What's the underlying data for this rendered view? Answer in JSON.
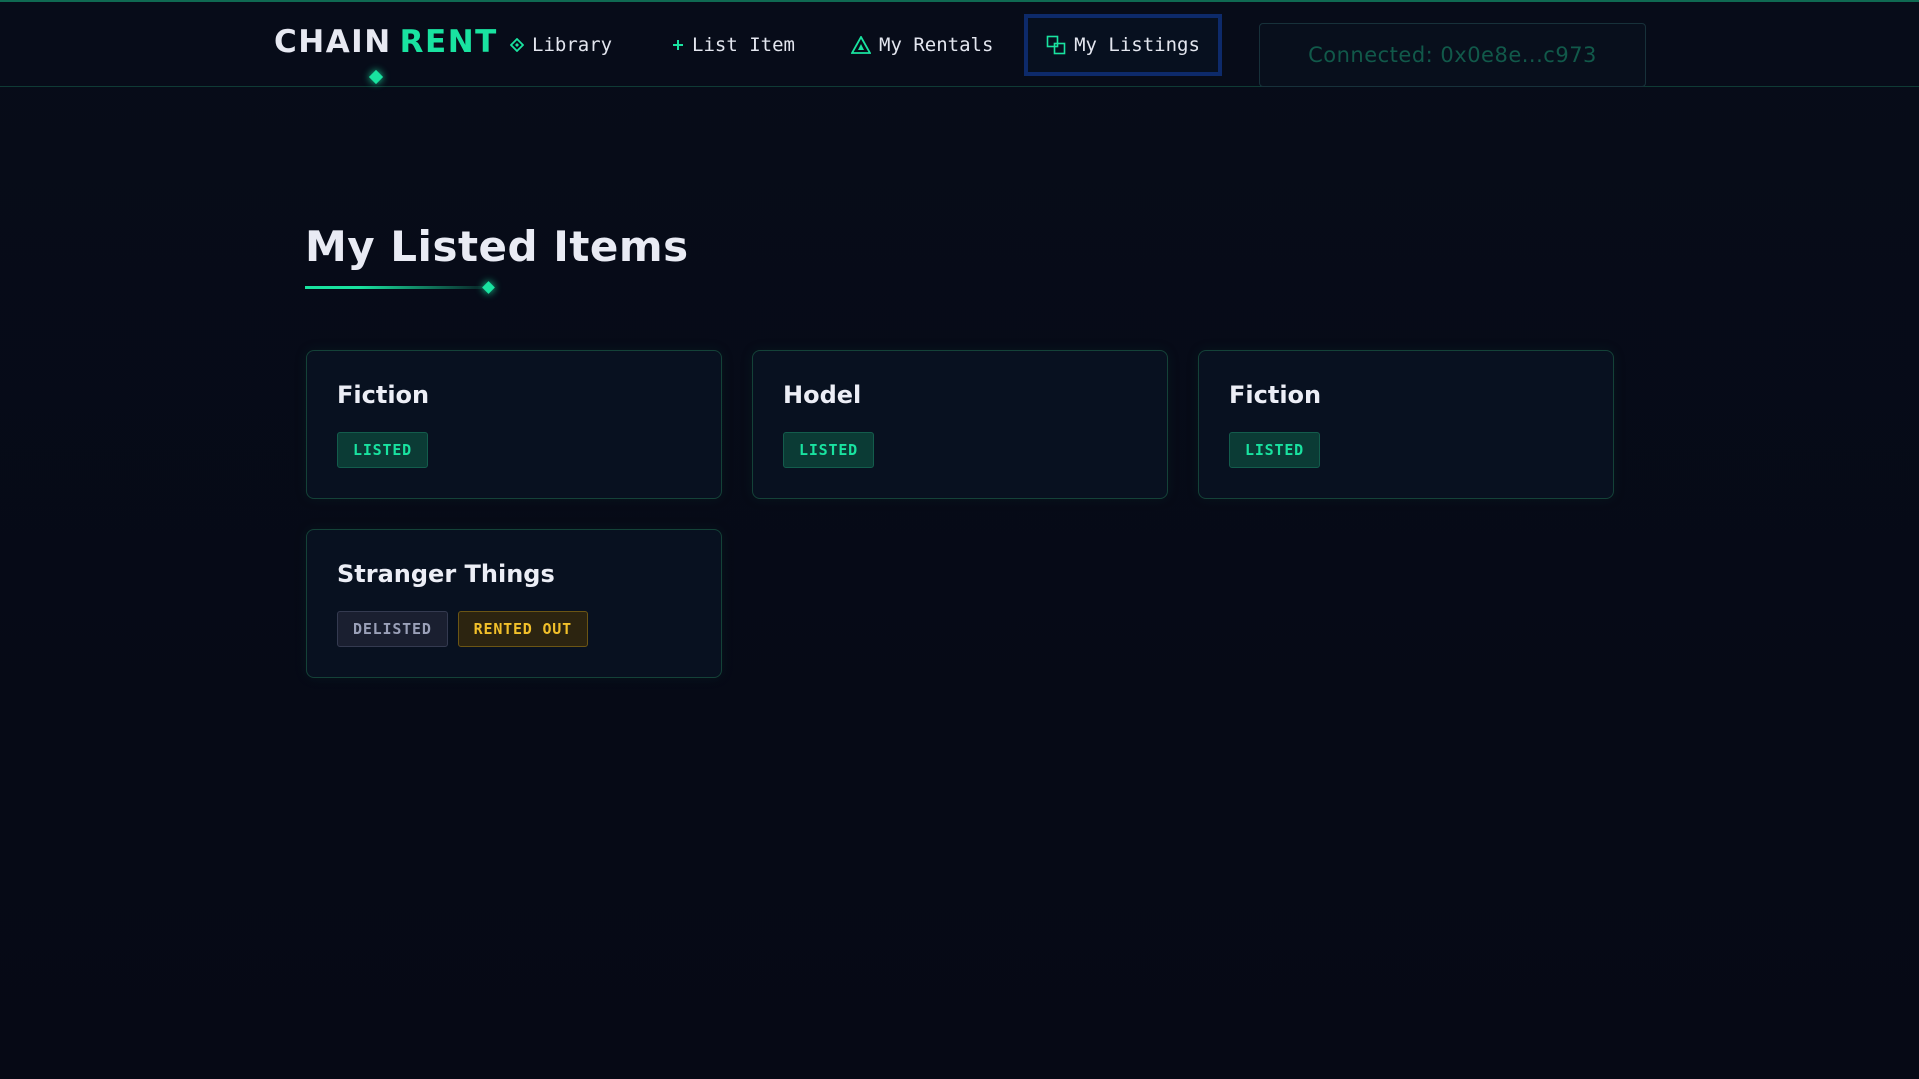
{
  "header": {
    "brand_word1": "CHAIN",
    "brand_word2": "RENT",
    "nav": [
      {
        "label": "Library",
        "icon": "diamond-icon"
      },
      {
        "label": "List Item",
        "icon": "plus-icon"
      },
      {
        "label": "My Rentals",
        "icon": "triangle-icon"
      },
      {
        "label": "My Listings",
        "icon": "squares-icon",
        "active": true
      }
    ],
    "wallet": "Connected: 0x0e8e...c973"
  },
  "main": {
    "title": "My Listed Items",
    "cards": [
      {
        "title": "Fiction",
        "badges": [
          "LISTED"
        ]
      },
      {
        "title": "Hodel",
        "badges": [
          "LISTED"
        ]
      },
      {
        "title": "Fiction",
        "badges": [
          "LISTED"
        ]
      },
      {
        "title": "Stranger Things",
        "badges": [
          "DELISTED",
          "RENTED OUT"
        ]
      }
    ]
  },
  "colors": {
    "accent": "#19e3a0",
    "background": "#060a16",
    "active_nav_border": "#0d2a6a",
    "rented_badge": "#f2c02a",
    "delisted_badge": "#9aa0b8"
  }
}
